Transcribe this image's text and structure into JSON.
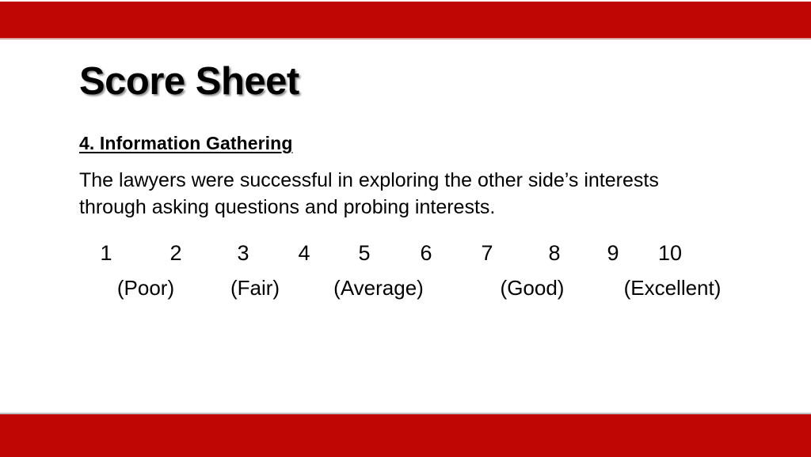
{
  "theme": {
    "bar_color": "#c00505",
    "background": "#ffffff",
    "text_color": "#000000"
  },
  "slide": {
    "title": "Score Sheet",
    "section_heading": "4. Information Gathering",
    "body_lines": [
      "The lawyers were successful in exploring the other side’s interests",
      "through asking questions and probing interests."
    ],
    "scale": {
      "numbers": [
        "1",
        "2",
        "3",
        "4",
        "5",
        "6",
        "7",
        "8",
        "9",
        "10"
      ],
      "labels": [
        "(Poor)",
        "(Fair)",
        "(Average)",
        "(Good)",
        "(Excellent)"
      ]
    }
  }
}
